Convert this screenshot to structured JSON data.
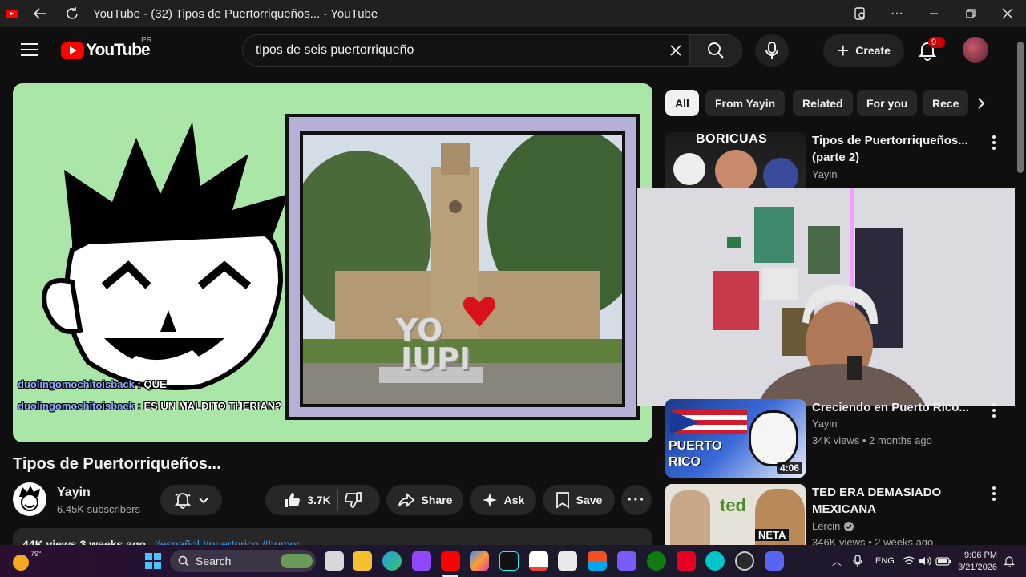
{
  "browser": {
    "tab_title": "YouTube - (32) Tipos de Puertorriqueños... - YouTube"
  },
  "header": {
    "logo": "YouTube",
    "country_code": "PR",
    "search_query": "tipos de seis puertorriqueño",
    "create_label": "Create",
    "notification_count": "9+"
  },
  "video": {
    "title": "Tipos de Puertorriqueños...",
    "channel": "Yayin",
    "subscribers": "6.45K subscribers",
    "likes": "3.7K",
    "share_label": "Share",
    "ask_label": "Ask",
    "save_label": "Save",
    "description_stats": "44K views  3 weeks ago",
    "description_tags": "#español #puertorico #humor",
    "sign_text_1": "YO",
    "sign_text_2": "IUPI"
  },
  "chat": [
    {
      "user": "duolingomochitoisback",
      "message": ": QUE"
    },
    {
      "user": "duolingomochitoisback",
      "message": ": ES UN MALDITO THERIAN?"
    }
  ],
  "chips": [
    "All",
    "From Yayin",
    "Related",
    "For you",
    "Rece"
  ],
  "recommendations": [
    {
      "title": "Tipos de Puertorriqueños... (parte 2)",
      "channel": "Yayin",
      "thumb_text": "BORICUAS"
    },
    {
      "title": "Creciendo en Puerto Rico...",
      "channel": "Yayin",
      "views": "34K views",
      "age": "2 months ago",
      "duration": "4:06",
      "thumb_text_1": "PUERTO",
      "thumb_text_2": "RICO"
    },
    {
      "title": "TED ERA DEMASIADO MEXICANA",
      "channel": "Lercin",
      "views": "346K views",
      "age": "2 weeks ago",
      "thumb_text_1": "ted",
      "thumb_text_2": "NETA"
    }
  ],
  "taskbar": {
    "weather": "79°",
    "search_label": "Search",
    "language": "ENG",
    "time": "9:06 PM",
    "date": "3/21/2026"
  },
  "colors": {
    "youtube_red": "#ff0000",
    "player_bg": "#a9e6a8",
    "link_blue": "#3ea6ff"
  }
}
